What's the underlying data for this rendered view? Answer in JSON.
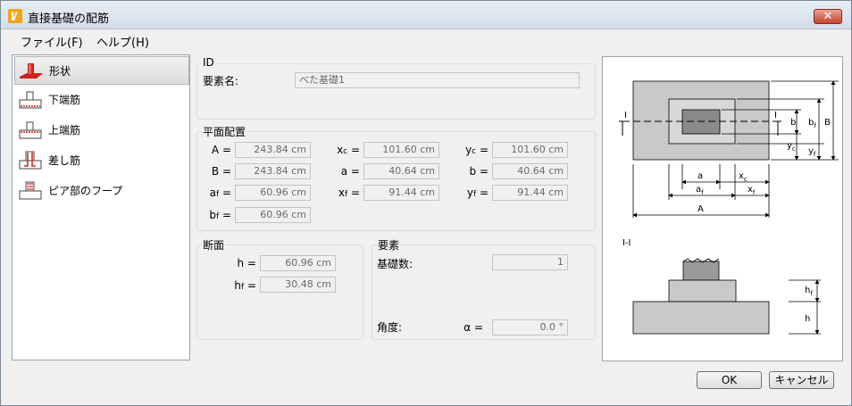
{
  "window": {
    "title": "直接基礎の配筋",
    "close_label": "✕"
  },
  "menu": {
    "file": "ファイル(F)",
    "help": "ヘルプ(H)"
  },
  "sidebar": {
    "items": [
      {
        "label": "形状",
        "icon": "footing-shape-icon"
      },
      {
        "label": "下端筋",
        "icon": "bottom-rebar-icon"
      },
      {
        "label": "上端筋",
        "icon": "top-rebar-icon"
      },
      {
        "label": "差し筋",
        "icon": "dowel-rebar-icon"
      },
      {
        "label": "ピア部のフープ",
        "icon": "pier-hoop-icon"
      }
    ]
  },
  "id_group": {
    "title": "ID",
    "name_label": "要素名:",
    "name_value": "べた基礎1"
  },
  "plan_group": {
    "title": "平面配置",
    "A": {
      "label": "A =",
      "value": "243.84 cm"
    },
    "B": {
      "label": "B =",
      "value": "243.84 cm"
    },
    "af": {
      "label": "a",
      "sub": "f",
      "eq": " =",
      "value": "60.96 cm"
    },
    "bf": {
      "label": "b",
      "sub": "f",
      "eq": " =",
      "value": "60.96 cm"
    },
    "xc": {
      "label": "x",
      "sub": "c",
      "eq": " =",
      "value": "101.60 cm"
    },
    "a": {
      "label": "a =",
      "value": "40.64 cm"
    },
    "xf": {
      "label": "x",
      "sub": "f",
      "eq": " =",
      "value": "91.44 cm"
    },
    "yc": {
      "label": "y",
      "sub": "c",
      "eq": " =",
      "value": "101.60 cm"
    },
    "b": {
      "label": "b =",
      "value": "40.64 cm"
    },
    "yf": {
      "label": "y",
      "sub": "f",
      "eq": " =",
      "value": "91.44 cm"
    }
  },
  "section_group": {
    "title": "断面",
    "h": {
      "label": "h =",
      "value": "60.96 cm"
    },
    "hf": {
      "label": "h",
      "sub": "f",
      "eq": " =",
      "value": "30.48 cm"
    }
  },
  "element_group": {
    "title": "要素",
    "count_label": "基礎数:",
    "count_value": "1",
    "angle_label": "角度:",
    "alpha_label": "α =",
    "angle_value": "0.0 °"
  },
  "diagram": {
    "section_mark": "I",
    "section_title": "I-I",
    "dims": {
      "a": "a",
      "xc": "x",
      "af": "a",
      "xf": "x",
      "A": "A",
      "b": "b",
      "bf": "b",
      "B": "B",
      "yc": "y",
      "yf": "y",
      "hf": "h",
      "h": "h",
      "sub_c": "c",
      "sub_f": "f"
    }
  },
  "buttons": {
    "ok": "OK",
    "cancel": "キャンセル"
  }
}
